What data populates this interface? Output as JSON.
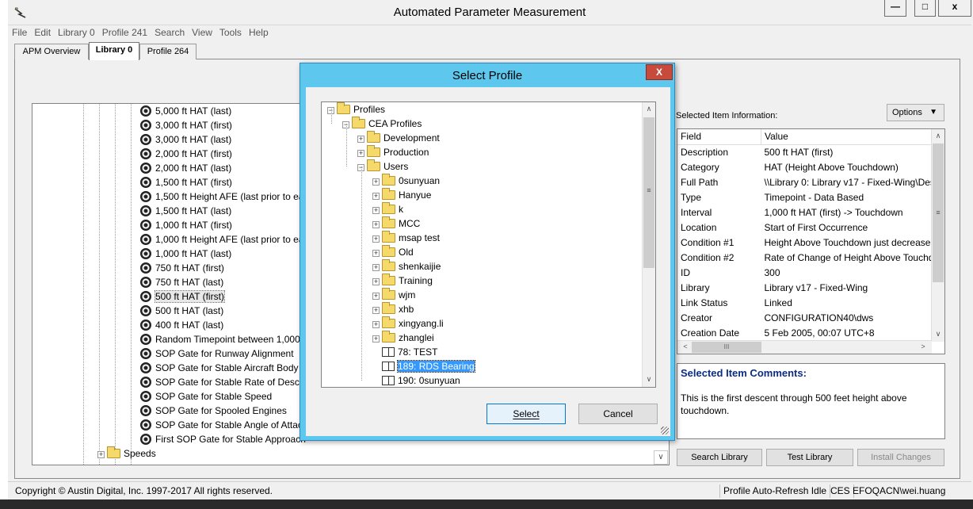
{
  "window": {
    "title": "Automated Parameter Measurement",
    "min_label": "―",
    "max_label": "□",
    "close_label": "x"
  },
  "menu": [
    "File",
    "Edit",
    "Library 0",
    "Profile 241",
    "Search",
    "View",
    "Tools",
    "Help"
  ],
  "tabs": [
    "APM Overview",
    "Library 0",
    "Profile 264"
  ],
  "active_tab": "Library 0",
  "left_tree": {
    "items": [
      "5,000 ft HAT (last)",
      "3,000 ft HAT (first)",
      "3,000 ft HAT (last)",
      "2,000 ft HAT (first)",
      "2,000 ft HAT (last)",
      "1,500 ft HAT (first)",
      "1,500 ft Height AFE (last prior to ea",
      "1,500 ft HAT (last)",
      "1,000 ft HAT (first)",
      "1,000 ft Height AFE (last prior to ea",
      "1,000 ft HAT (last)",
      "750 ft HAT (first)",
      "750 ft HAT (last)",
      "500 ft HAT (first)",
      "500 ft HAT (last)",
      "400 ft HAT (last)",
      "Random Timepoint between 1,000",
      "SOP Gate for Runway Alignment",
      "SOP Gate for Stable Aircraft Body R",
      "SOP Gate for Stable Rate of Descen",
      "SOP Gate for Stable Speed",
      "SOP Gate for Spooled Engines",
      "SOP Gate for Stable Angle of Attac",
      "First SOP Gate for Stable Approach"
    ],
    "selected": "500 ft HAT (first)",
    "folder": "Speeds",
    "scroll_down": "∨"
  },
  "info": {
    "label": "Selected Item Information:",
    "options_label": "Options",
    "options_arrow": "▼",
    "col_field": "Field",
    "col_value": "Value",
    "rows": [
      {
        "field": "Description",
        "value": "500 ft HAT (first)"
      },
      {
        "field": "Category",
        "value": "HAT (Height Above Touchdown)"
      },
      {
        "field": "Full Path",
        "value": "\\\\Library 0: Library v17 - Fixed-Wing\\Des"
      },
      {
        "field": "Type",
        "value": "Timepoint - Data Based"
      },
      {
        "field": "Interval",
        "value": "1,000 ft HAT (first) -> Touchdown"
      },
      {
        "field": "Location",
        "value": "Start of First Occurrence"
      },
      {
        "field": "Condition #1",
        "value": "Height Above Touchdown just decrease"
      },
      {
        "field": "Condition #2",
        "value": "Rate of Change of Height Above Touchd"
      },
      {
        "field": "ID",
        "value": "300"
      },
      {
        "field": "Library",
        "value": "Library v17 - Fixed-Wing"
      },
      {
        "field": "Link Status",
        "value": "Linked"
      },
      {
        "field": "Creator",
        "value": "CONFIGURATION40\\dws"
      },
      {
        "field": "Creation Date",
        "value": "5 Feb 2005, 00:07 UTC+8"
      }
    ],
    "scroll_up": "∧",
    "scroll_mid": "≡",
    "scroll_down": "∨",
    "scroll_left": "<",
    "scroll_hmid": "III",
    "scroll_right": ">"
  },
  "comments": {
    "title": "Selected Item Comments:",
    "text": "This is the first descent through 500 feet height above touchdown."
  },
  "buttons": {
    "search_library": "Search Library",
    "test_library": "Test Library",
    "install_changes": "Install Changes"
  },
  "status": {
    "copyright": "Copyright © Austin Digital, Inc. 1997-2017 All rights reserved.",
    "refresh": "Profile Auto-Refresh Idle",
    "ces": "CES",
    "user": "EFOQACN\\wei.huang"
  },
  "dialog": {
    "title": "Select Profile",
    "close_label": "X",
    "tree": [
      {
        "label": "Profiles",
        "level": 0,
        "icon": "folder-icon",
        "exp": "−"
      },
      {
        "label": "CEA Profiles",
        "level": 1,
        "icon": "folder-icon",
        "exp": "−"
      },
      {
        "label": "Development",
        "level": 2,
        "icon": "folder-icon",
        "exp": "+"
      },
      {
        "label": "Production",
        "level": 2,
        "icon": "folder-icon",
        "exp": "+"
      },
      {
        "label": "Users",
        "level": 2,
        "icon": "folder-icon",
        "exp": "−"
      },
      {
        "label": "0sunyuan",
        "level": 3,
        "icon": "folder-icon",
        "exp": "+"
      },
      {
        "label": "Hanyue",
        "level": 3,
        "icon": "folder-icon",
        "exp": "+"
      },
      {
        "label": "k",
        "level": 3,
        "icon": "folder-icon",
        "exp": "+"
      },
      {
        "label": "MCC",
        "level": 3,
        "icon": "folder-icon",
        "exp": "+"
      },
      {
        "label": "msap test",
        "level": 3,
        "icon": "folder-icon",
        "exp": "+"
      },
      {
        "label": "Old",
        "level": 3,
        "icon": "folder-icon",
        "exp": "+"
      },
      {
        "label": "shenkaijie",
        "level": 3,
        "icon": "folder-icon",
        "exp": "+"
      },
      {
        "label": "Training",
        "level": 3,
        "icon": "folder-icon",
        "exp": "+"
      },
      {
        "label": "wjm",
        "level": 3,
        "icon": "folder-icon",
        "exp": "+"
      },
      {
        "label": "xhb",
        "level": 3,
        "icon": "folder-icon",
        "exp": "+"
      },
      {
        "label": "xingyang.li",
        "level": 3,
        "icon": "folder-icon",
        "exp": "+"
      },
      {
        "label": "zhanglei",
        "level": 3,
        "icon": "folder-icon",
        "exp": "+"
      },
      {
        "label": "78: TEST",
        "level": 3,
        "icon": "book-icon",
        "exp": ""
      },
      {
        "label": "189: RDS Bearing",
        "level": 3,
        "icon": "book-icon",
        "exp": ""
      },
      {
        "label": "190: 0sunyuan",
        "level": 3,
        "icon": "book-icon",
        "exp": ""
      }
    ],
    "selected": "189: RDS Bearing",
    "select_label": "Select",
    "cancel_label": "Cancel",
    "scroll_up": "∧",
    "scroll_mid": "≡",
    "scroll_down": "∨"
  }
}
